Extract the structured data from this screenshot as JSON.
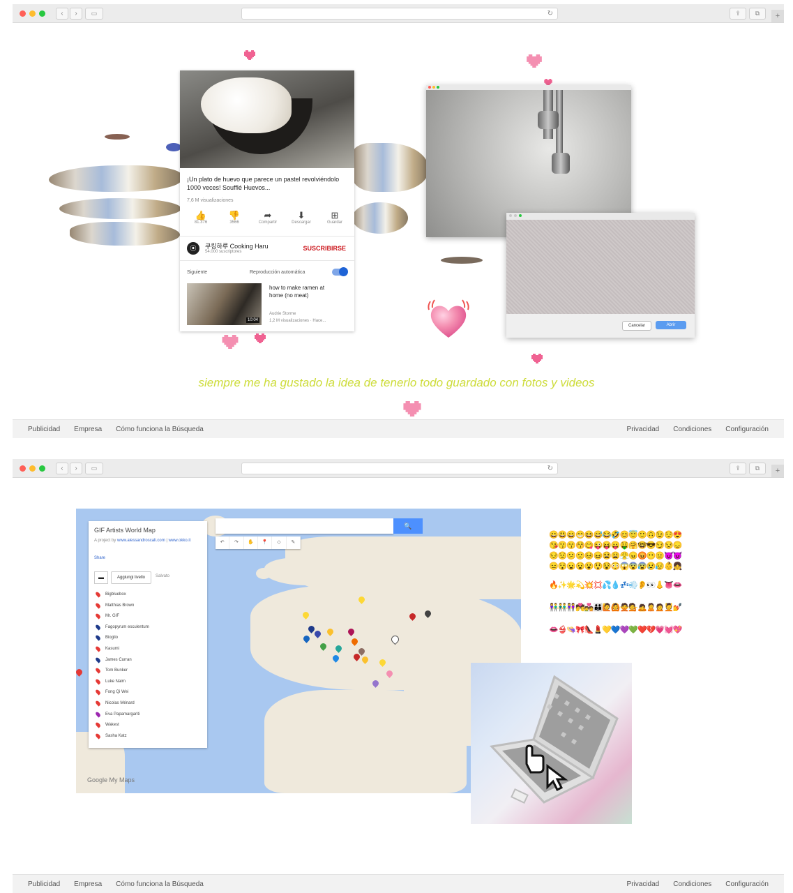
{
  "colors": {
    "heart_pink": "#f48fb1",
    "caption_green": "#cddc39",
    "yt_red": "#cc181e",
    "map_blue": "#4d90fe",
    "close": "#ff5f57",
    "minimize": "#febc2e",
    "zoom": "#28c840"
  },
  "browser": {
    "reload_icon": "↻",
    "back_icon": "‹",
    "forward_icon": "›",
    "sidebar_icon": "▭",
    "share_icon": "⇪",
    "tabs_icon": "⧉",
    "plus_icon": "+"
  },
  "youtube": {
    "title": "¡Un plato de huevo que parece un pastel revolviéndolo 1000 veces! Soufflé Huevos...",
    "views": "7,6 M visualizaciones",
    "actions": [
      {
        "icon": "👍",
        "label": "81.376"
      },
      {
        "icon": "👎",
        "label": "3566"
      },
      {
        "icon": "➦",
        "label": "Compartir"
      },
      {
        "icon": "⬇",
        "label": "Descargar"
      },
      {
        "icon": "⊞",
        "label": "Guardar"
      }
    ],
    "channel_name": "쿠킹하루 Cooking Haru",
    "channel_subs": "54.000 suscriptores",
    "subscribe": "SUSCRIBIRSE",
    "next": "Siguiente",
    "autoplay": "Reproducción automática",
    "rec_title": "how to make ramen at home (no meat)",
    "rec_author": "Audrie Storme",
    "rec_views": "1,2 M visualizaciones · Hace...",
    "rec_duration": "10:04"
  },
  "dialog": {
    "cancel": "Cancelar",
    "open": "Abrir"
  },
  "caption": "siempre me ha gustado la idea de tenerlo todo guardado con fotos y videos",
  "footer": {
    "left": [
      "Publicidad",
      "Empresa",
      "Cómo funciona la Búsqueda"
    ],
    "right": [
      "Privacidad",
      "Condiciones",
      "Configuración"
    ]
  },
  "map": {
    "title": "GIF Artists World Map",
    "by_prefix": "A project by ",
    "by_link1": "www.alessandroscali.com",
    "by_sep": " | ",
    "by_link2": "www.okko.it",
    "share": "Share",
    "add_layer": "Aggiungi livello",
    "saved": "Salvato",
    "search_icon": "🔍",
    "artists": [
      {
        "name": "Bigbluebox",
        "color": "#e53935"
      },
      {
        "name": "Matthias Brown",
        "color": "#e53935"
      },
      {
        "name": "Mr. GIF",
        "color": "#e53935"
      },
      {
        "name": "Fagopyrum esculentum",
        "color": "#1e3a8a"
      },
      {
        "name": "Bioglio",
        "color": "#1e3a8a"
      },
      {
        "name": "Kasumi",
        "color": "#e53935"
      },
      {
        "name": "James Curran",
        "color": "#1e3a8a"
      },
      {
        "name": "Tom Bunker",
        "color": "#e53935"
      },
      {
        "name": "Luke Nairn",
        "color": "#e53935"
      },
      {
        "name": "Fong Qi Wei",
        "color": "#e53935"
      },
      {
        "name": "Nicolas Ménard",
        "color": "#e53935"
      },
      {
        "name": "Eva Papamargariti",
        "color": "#9c27b0"
      },
      {
        "name": "Wakest",
        "color": "#e53935"
      },
      {
        "name": "Sasha Katz",
        "color": "#e53935"
      }
    ],
    "tools": [
      "↶",
      "↷",
      "✋",
      "📍",
      "◇",
      "✎"
    ],
    "google_label": "Google My Maps"
  },
  "emoji_rows": [
    "😀😃😄😁😆😅😂🤣😊😇🙂🙃😉😌😍",
    "😘😗😙😚😋😜😝😛🤑🤗🤓😎😏😒😞",
    "😔😟😕🙁😣😖😫😩😤😠😡😶😐😈👿",
    "😑😯😦😧😮😲😵😳😱😨😰😢😥👶👧",
    "",
    "🔥✨🌟💫💥💢💦💧💤💨👂👀👃👅👄",
    "👫👬👭💏💑👪🙋🙆🙅💁🙇🙎🙍💆💅",
    "👄👙👒🎀👠💄💛💙💜💚❤️💔💗💓💖"
  ]
}
